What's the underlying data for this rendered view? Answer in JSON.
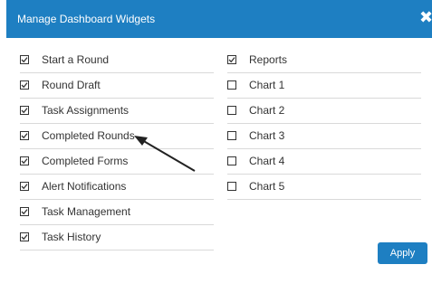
{
  "dialog": {
    "title": "Manage Dashboard Widgets",
    "close_icon": "close-icon",
    "apply_label": "Apply",
    "accent_color": "#1E7FC2"
  },
  "widgets_left": [
    {
      "label": "Start a Round",
      "checked": true
    },
    {
      "label": "Round Draft",
      "checked": true
    },
    {
      "label": "Task Assignments",
      "checked": true
    },
    {
      "label": "Completed Rounds",
      "checked": true
    },
    {
      "label": "Completed Forms",
      "checked": true
    },
    {
      "label": "Alert Notifications",
      "checked": true
    },
    {
      "label": "Task Management",
      "checked": true
    },
    {
      "label": "Task History",
      "checked": true
    }
  ],
  "widgets_right": [
    {
      "label": "Reports",
      "checked": true
    },
    {
      "label": "Chart 1",
      "checked": false
    },
    {
      "label": "Chart 2",
      "checked": false
    },
    {
      "label": "Chart 3",
      "checked": false
    },
    {
      "label": "Chart 4",
      "checked": false
    },
    {
      "label": "Chart 5",
      "checked": false
    }
  ]
}
